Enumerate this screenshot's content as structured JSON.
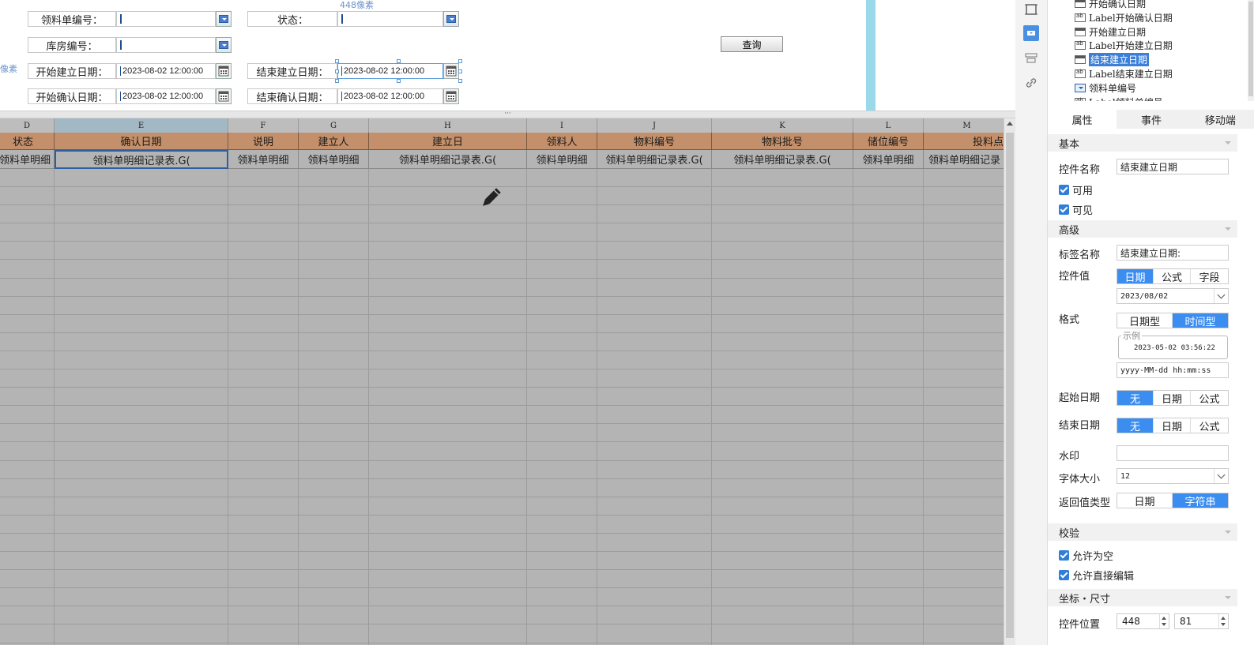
{
  "form": {
    "material_no_label": "领料单编号：",
    "status_label": "状态：",
    "warehouse_no_label": "库房编号：",
    "start_create_label": "开始建立日期：",
    "start_create_value": "2023-08-02 12:00:00",
    "end_create_label": "结束建立日期：",
    "end_create_value": "2023-08-02 12:00:00",
    "start_confirm_label": "开始确认日期：",
    "start_confirm_value": "2023-08-02 12:00:00",
    "end_confirm_label": "结束确认日期：",
    "end_confirm_value": "2023-08-02 12:00:00",
    "query_button": "查询",
    "px_hint_top": "448像素",
    "px_hint_left": "像素"
  },
  "sheet": {
    "columns": [
      {
        "letter": "D",
        "header": "状态",
        "cell": "领料单明细"
      },
      {
        "letter": "E",
        "header": "确认日期",
        "cell": "领料单明细记录表.G("
      },
      {
        "letter": "F",
        "header": "说明",
        "cell": "领料单明细"
      },
      {
        "letter": "G",
        "header": "建立人",
        "cell": "领料单明细"
      },
      {
        "letter": "H",
        "header": "建立日",
        "cell": "领料单明细记录表.G("
      },
      {
        "letter": "I",
        "header": "领料人",
        "cell": "领料单明细"
      },
      {
        "letter": "J",
        "header": "物料编号",
        "cell": "领料单明细记录表.G("
      },
      {
        "letter": "K",
        "header": "物料批号",
        "cell": "领料单明细记录表.G("
      },
      {
        "letter": "L",
        "header": "储位编号",
        "cell": "领料单明细"
      },
      {
        "letter": "M",
        "header": "投料点",
        "cell": "领料单明细记录"
      }
    ],
    "splitter_glyph": "···"
  },
  "tree": {
    "items": [
      {
        "text": "开始确认日期",
        "kind": "cal"
      },
      {
        "text": "Label开始确认日期",
        "kind": "lbl"
      },
      {
        "text": "开始建立日期",
        "kind": "cal"
      },
      {
        "text": "Label开始建立日期",
        "kind": "lbl"
      },
      {
        "text": "结束建立日期",
        "kind": "cal",
        "selected": true
      },
      {
        "text": "Label结束建立日期",
        "kind": "lbl"
      },
      {
        "text": "领料单编号",
        "kind": "dd"
      },
      {
        "text": "Label领料单编号",
        "kind": "lbl"
      }
    ]
  },
  "panel": {
    "tabs": [
      "属性",
      "事件",
      "移动端"
    ],
    "basic_section": "基本",
    "control_name_label": "控件名称",
    "control_name_value": "结束建立日期",
    "enabled_label": "可用",
    "visible_label": "可见",
    "advanced_section": "高级",
    "tag_name_label": "标签名称",
    "tag_name_value": "结束建立日期:",
    "control_value_label": "控件值",
    "control_value_opts": [
      "日期",
      "公式",
      "字段"
    ],
    "control_value_date": "2023/08/02",
    "format_label": "格式",
    "format_opts": [
      "日期型",
      "时间型"
    ],
    "example_label": "示例",
    "example_value": "2023-05-02 03:56:22",
    "format_pattern": "yyyy-MM-dd hh:mm:ss",
    "start_date_label": "起始日期",
    "end_date_label": "结束日期",
    "range_opts": [
      "无",
      "日期",
      "公式"
    ],
    "watermark_label": "水印",
    "font_size_label": "字体大小",
    "font_size_value": "12",
    "return_type_label": "返回值类型",
    "return_type_opts": [
      "日期",
      "字符串"
    ],
    "validation_section": "校验",
    "allow_empty_label": "允许为空",
    "allow_edit_label": "允许直接编辑",
    "coords_section": "坐标・尺寸",
    "position_label": "控件位置",
    "position_x": "448",
    "position_y": "81"
  },
  "colors": {
    "header_bg": "#c4906b",
    "sheet_bg": "#b4b4b4",
    "accent": "#3b8df0",
    "selection_border": "#2d5fa0"
  }
}
